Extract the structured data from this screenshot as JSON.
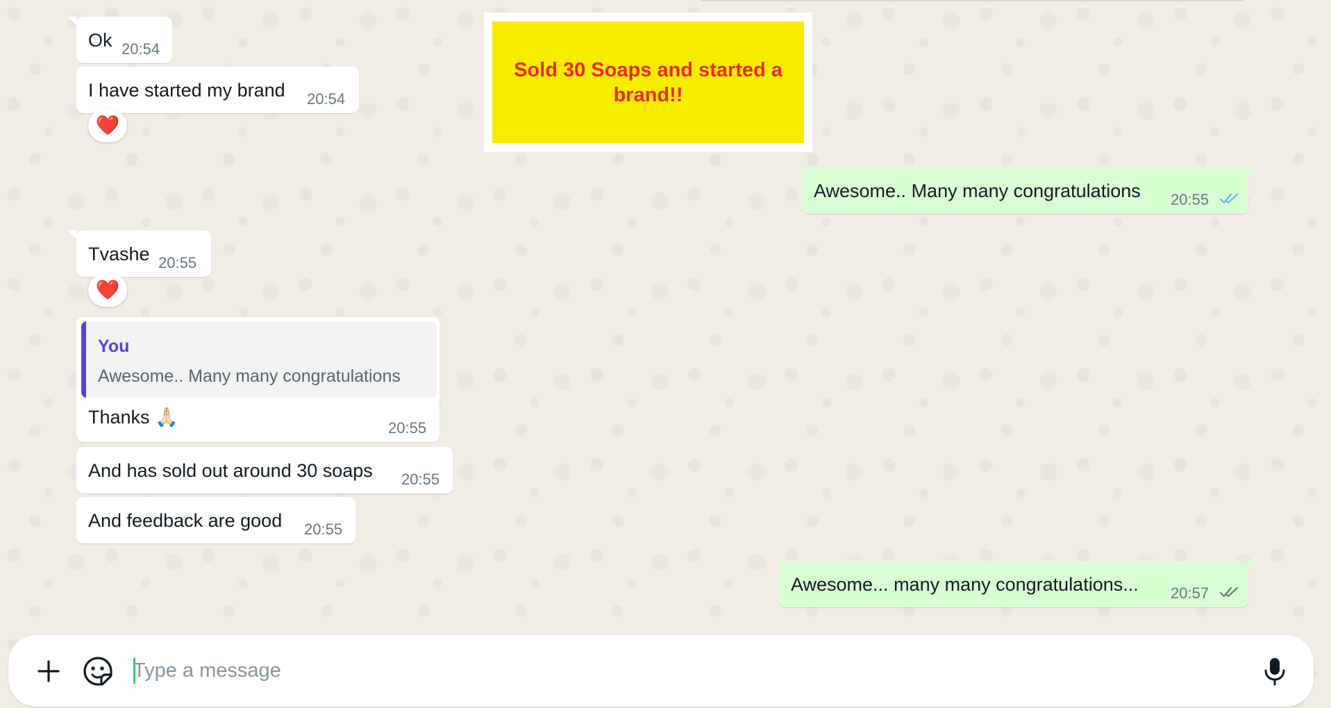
{
  "messages": [
    {
      "id": "m1",
      "direction": "in",
      "text": "Ok",
      "time": "20:54"
    },
    {
      "id": "m2",
      "direction": "in",
      "text": "I have started my brand",
      "time": "20:54",
      "reaction": "❤️"
    },
    {
      "id": "m3",
      "direction": "out",
      "text": "Awesome.. Many many congratulations",
      "time": "20:55",
      "status": "read"
    },
    {
      "id": "m4",
      "direction": "in",
      "text": "Tvashe",
      "time": "20:55",
      "reaction": "❤️"
    },
    {
      "id": "m5",
      "direction": "in",
      "text": "Thanks 🙏🏻",
      "time": "20:55",
      "quote": {
        "author": "You",
        "text": "Awesome.. Many many congratulations"
      }
    },
    {
      "id": "m6",
      "direction": "in",
      "text": "And has sold out around 30 soaps",
      "time": "20:55"
    },
    {
      "id": "m7",
      "direction": "in",
      "text": "And feedback are good",
      "time": "20:55"
    },
    {
      "id": "m8",
      "direction": "out",
      "text": "Awesome... many many congratulations...",
      "time": "20:57",
      "status": "delivered"
    }
  ],
  "sticker": {
    "text": "Sold 30 Soaps and started a brand!!",
    "background": "#f6ed00",
    "text_color": "#ee2a1f"
  },
  "composer": {
    "placeholder": "Type a message",
    "attach_icon": "plus-icon",
    "sticker_icon": "sticker-icon",
    "mic_icon": "microphone-icon"
  },
  "colors": {
    "incoming_bubble": "#ffffff",
    "outgoing_bubble": "#d9fdd3",
    "read_ticks": "#53bdeb",
    "delivered_ticks": "#667781",
    "quote_accent": "#5b40d9"
  }
}
